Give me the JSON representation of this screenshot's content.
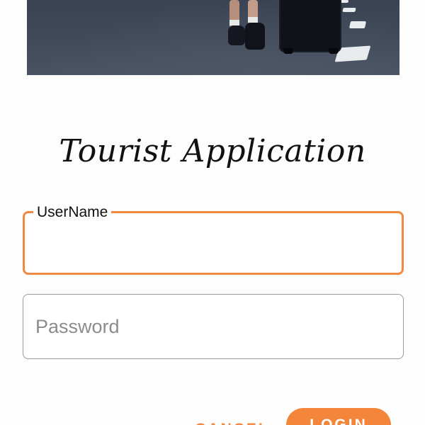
{
  "hero": {
    "image_icon": "traveler-with-suitcase-photo"
  },
  "app": {
    "title": "Tourist Application"
  },
  "form": {
    "username": {
      "label": "UserName",
      "value": ""
    },
    "password": {
      "placeholder": "Password",
      "value": ""
    }
  },
  "actions": {
    "cancel_label": "CANCEL",
    "login_label": "LOGIN"
  },
  "colors": {
    "accent": "#f08a42",
    "button_fill": "#f4863c",
    "field_border": "#9a9a9a",
    "text": "#111111",
    "placeholder": "#8c8c8c"
  }
}
